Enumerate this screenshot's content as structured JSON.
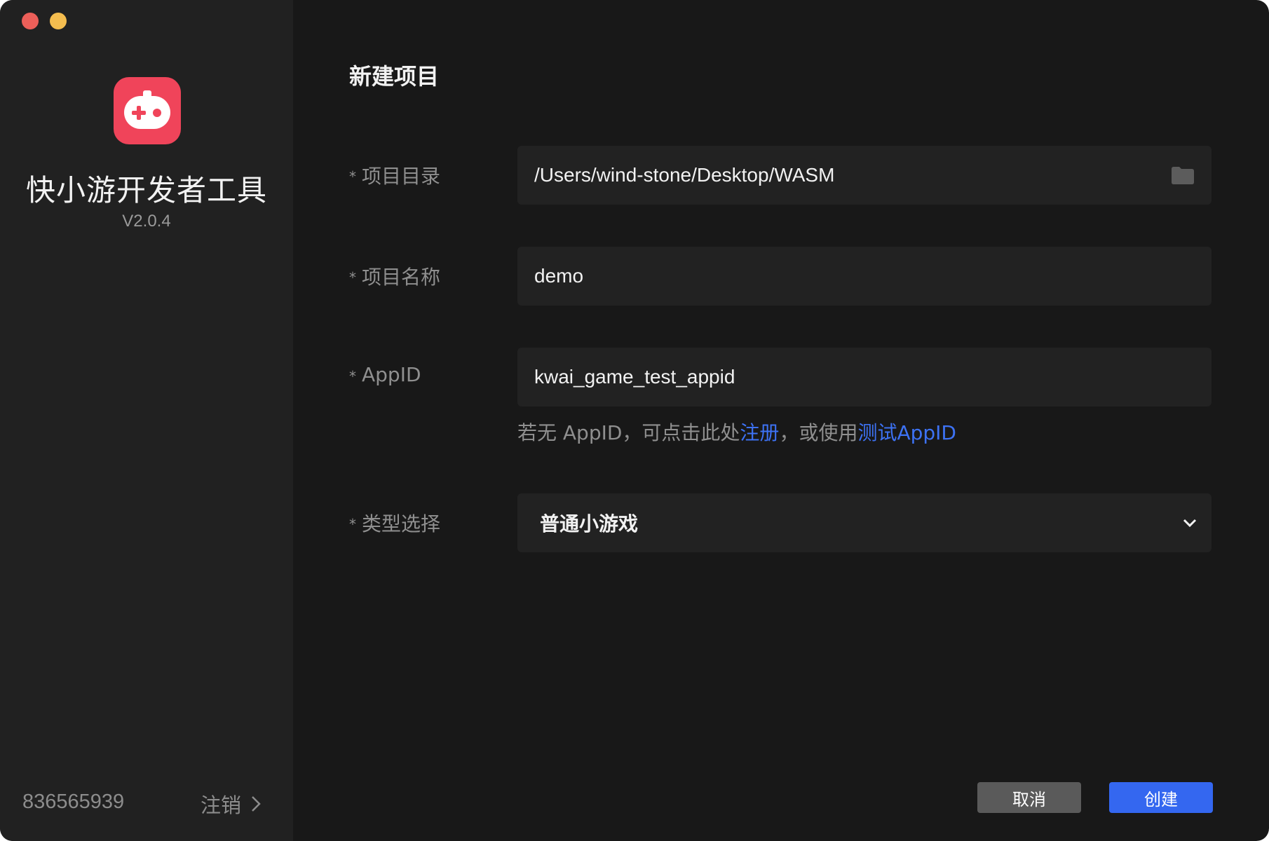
{
  "window": {
    "controls": [
      "close",
      "minimize"
    ]
  },
  "sidebar": {
    "app_name": "快小游开发者工具",
    "version": "V2.0.4",
    "logo_icon": "gamepad-icon",
    "account_id": "836565939",
    "logout_label": "注销",
    "logout_icon": "chevron-right-icon"
  },
  "main": {
    "title": "新建项目",
    "required_mark": "*",
    "fields": {
      "directory": {
        "label": "项目目录",
        "value": "/Users/wind-stone/Desktop/WASM",
        "icon": "folder-icon"
      },
      "name": {
        "label": "项目名称",
        "value": "demo"
      },
      "appid": {
        "label": "AppID",
        "value": "kwai_game_test_appid"
      },
      "type": {
        "label": "类型选择",
        "value": "普通小游戏",
        "icon": "chevron-down-icon"
      }
    },
    "hint": {
      "prefix": "若无 AppID，可点击此处",
      "register_link": "注册",
      "middle": "，或使用",
      "test_link": "测试AppID"
    },
    "buttons": {
      "cancel": "取消",
      "create": "创建"
    }
  },
  "colors": {
    "window_bg": "#181818",
    "sidebar_bg": "#212121",
    "input_bg": "#222222",
    "brand_red": "#f0445a",
    "link_blue": "#3d72f4",
    "primary_button": "#3467f0",
    "secondary_button": "#5a5a5a"
  }
}
